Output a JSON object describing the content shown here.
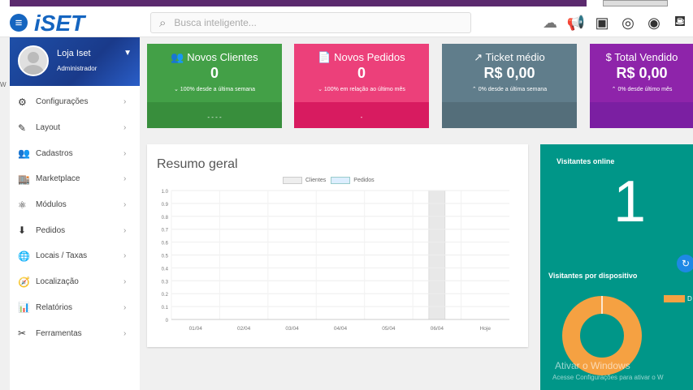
{
  "header": {
    "search_placeholder": "Busca inteligente..."
  },
  "profile": {
    "name": "Loja Iset",
    "role": "Administrador"
  },
  "sidebar": {
    "items": [
      {
        "label": "Configurações",
        "icon": "gears-icon"
      },
      {
        "label": "Layout",
        "icon": "brush-icon"
      },
      {
        "label": "Cadastros",
        "icon": "users-icon"
      },
      {
        "label": "Marketplace",
        "icon": "store-icon"
      },
      {
        "label": "Módulos",
        "icon": "modules-icon"
      },
      {
        "label": "Pedidos",
        "icon": "download-icon"
      },
      {
        "label": "Locais / Taxas",
        "icon": "globe-icon"
      },
      {
        "label": "Localização",
        "icon": "compass-icon"
      },
      {
        "label": "Relatórios",
        "icon": "chart-icon"
      },
      {
        "label": "Ferramentas",
        "icon": "tools-icon"
      }
    ]
  },
  "cards": [
    {
      "title": "Novos Clientes",
      "value": "0",
      "sub": "100% desde a última semana",
      "footer": "- - - -",
      "color": "#43a047",
      "color_dark": "#388e3c"
    },
    {
      "title": "Novos Pedidos",
      "value": "0",
      "sub": "100% em relação ao último mês",
      "footer": "-",
      "color": "#ec407a",
      "color_dark": "#d81b60"
    },
    {
      "title": "Ticket médio",
      "value": "R$ 0,00",
      "sub": "0% desde a última semana",
      "footer": "",
      "color": "#607d8b",
      "color_dark": "#546e7a"
    },
    {
      "title": "$ Total Vendido",
      "value": "R$ 0,00",
      "sub": "0% desde último mês",
      "footer": "",
      "color": "#8e24aa",
      "color_dark": "#7b1fa2"
    }
  ],
  "summary": {
    "title": "Resumo geral",
    "legend": [
      "Clientes",
      "Pedidos"
    ]
  },
  "chart_data": {
    "type": "bar",
    "categories": [
      "01/04",
      "02/04",
      "03/04",
      "04/04",
      "05/04",
      "06/04",
      "Hoje"
    ],
    "series": [
      {
        "name": "Clientes",
        "values": [
          0,
          0,
          0,
          0,
          0,
          0,
          0
        ]
      },
      {
        "name": "Pedidos",
        "values": [
          0,
          0,
          0,
          0,
          0,
          0,
          0
        ]
      }
    ],
    "ylim": [
      0,
      1.0
    ],
    "yticks": [
      "1.0",
      "0.9",
      "0.8",
      "0.7",
      "0.6",
      "0.5",
      "0.4",
      "0.3",
      "0.2",
      "0.1",
      "0"
    ],
    "highlight_category": "06/04",
    "legend_position": "top"
  },
  "visitors": {
    "online_label": "Visitantes online",
    "online_value": "1",
    "device_label": "Visitantes por dispositivo",
    "device_legend": "D",
    "device_color": "#f5a142"
  },
  "watermark": {
    "line1": "Ativar o Windows",
    "line2": "Acesse Configurações para ativar o W"
  }
}
